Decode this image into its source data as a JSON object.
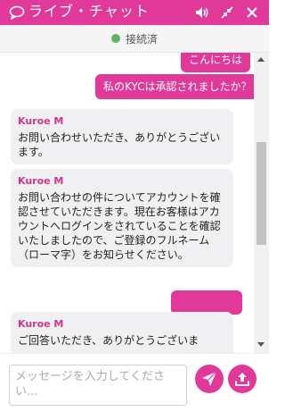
{
  "header": {
    "title": "ライブ・チャット",
    "bg_color": "#e0399a"
  },
  "status": {
    "text": "接続済",
    "dot_color": "#5cb85c"
  },
  "messages": [
    {
      "type": "outgoing",
      "text": "こんにちは"
    },
    {
      "type": "outgoing",
      "text": "私のKYCは承認されましたか？"
    },
    {
      "type": "incoming",
      "agent": "Kuroe M",
      "text": "お問い合わせいただき、ありがとうございます。"
    },
    {
      "type": "incoming",
      "agent": "Kuroe M",
      "text": "お問い合わせの件についてアカウントを確認させていただきます。現在お客様はアカウントへログインをされていることを確認いたしましたので、ご登録のフルネーム（ローマ字）をお知らせください。"
    },
    {
      "type": "outgoing",
      "text": ""
    },
    {
      "type": "incoming",
      "agent": "Kuroe M",
      "text": "ご回答いただき、ありがとうございま"
    }
  ],
  "composer": {
    "placeholder": "メッセージを入力してください..."
  },
  "icons": {
    "chat": "chat-bubble-icon",
    "volume": "volume-icon",
    "minimize": "minimize-icon",
    "close": "close-icon",
    "send": "send-icon",
    "upload": "upload-icon"
  }
}
